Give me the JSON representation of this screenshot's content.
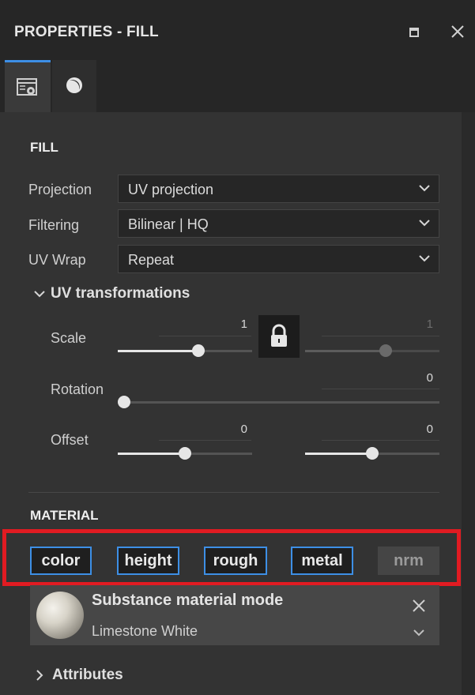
{
  "window": {
    "title": "PROPERTIES - FILL",
    "restore_icon": "restore-icon",
    "close_icon": "close-icon"
  },
  "tabs": [
    {
      "name": "layer-properties",
      "icon": "settings-panel-icon",
      "active": true
    },
    {
      "name": "material",
      "icon": "material-sphere-icon",
      "active": false
    }
  ],
  "fill": {
    "title": "FILL",
    "projection": {
      "label": "Projection",
      "value": "UV projection"
    },
    "filtering": {
      "label": "Filtering",
      "value": "Bilinear | HQ"
    },
    "uv_wrap": {
      "label": "UV Wrap",
      "value": "Repeat"
    }
  },
  "uv_transformations": {
    "title": "UV transformations",
    "expanded": true,
    "scale": {
      "label": "Scale",
      "value_u": "1",
      "value_v": "1",
      "locked": true,
      "level_u": 0.6,
      "level_v": 0.6
    },
    "rotation": {
      "label": "Rotation",
      "value": "0",
      "level": 0.0
    },
    "offset": {
      "label": "Offset",
      "value_u": "0",
      "value_v": "0",
      "level_u": 0.5,
      "level_v": 0.5
    }
  },
  "material": {
    "title": "MATERIAL",
    "channels": [
      {
        "label": "color",
        "enabled": true
      },
      {
        "label": "height",
        "enabled": true
      },
      {
        "label": "rough",
        "enabled": true
      },
      {
        "label": "metal",
        "enabled": true
      },
      {
        "label": "nrm",
        "enabled": false
      }
    ],
    "highlight_color": "#e11b22",
    "accent_color": "#3d8fe6",
    "mode_title": "Substance material mode",
    "mode_material": "Limestone White"
  },
  "attributes": {
    "title": "Attributes",
    "expanded": false
  }
}
